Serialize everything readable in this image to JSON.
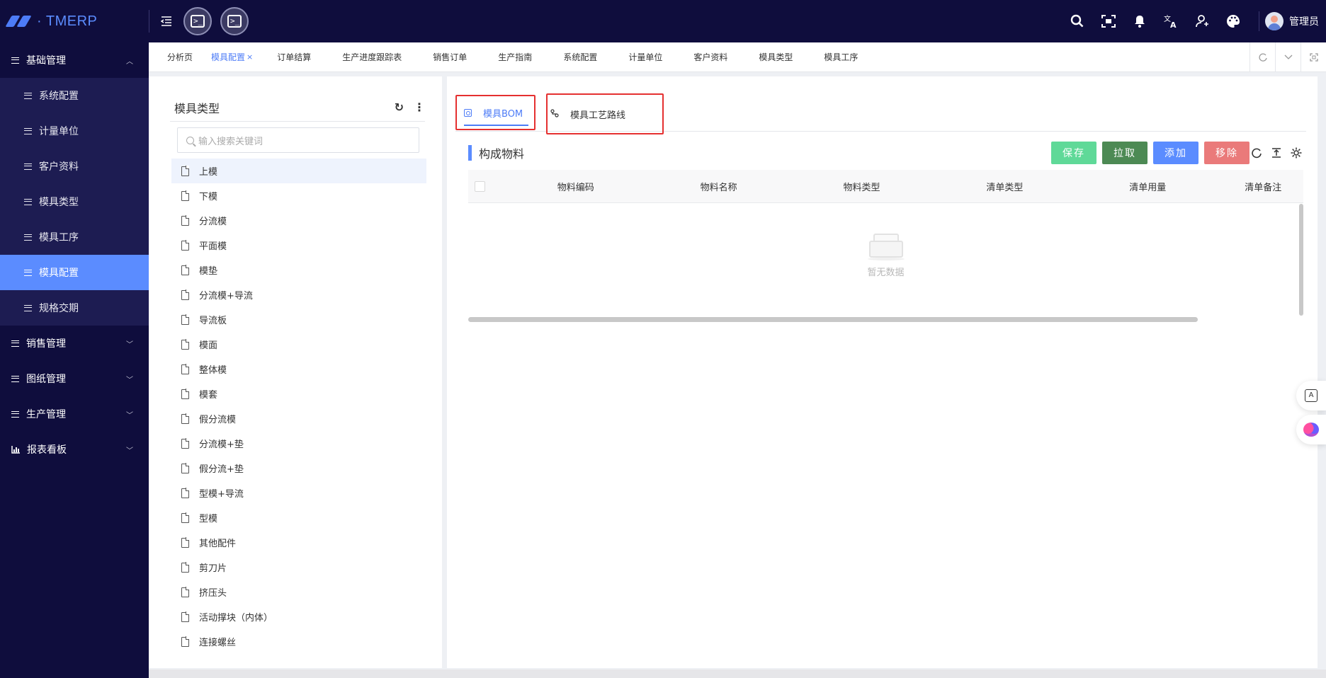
{
  "app": {
    "logo_text": "· TMERP"
  },
  "header": {
    "user_name": "管理员"
  },
  "sidebar": {
    "groups": [
      {
        "label": "基础管理",
        "expanded": true,
        "items": [
          "系统配置",
          "计量单位",
          "客户资料",
          "模具类型",
          "模具工序",
          "模具配置",
          "规格交期"
        ],
        "active_item": "模具配置"
      },
      {
        "label": "销售管理",
        "expanded": false
      },
      {
        "label": "图纸管理",
        "expanded": false
      },
      {
        "label": "生产管理",
        "expanded": false
      },
      {
        "label": "报表看板",
        "expanded": false
      }
    ]
  },
  "tabs": [
    "分析页",
    "模具配置",
    "订单结算",
    "生产进度跟踪表",
    "销售订单",
    "生产指南",
    "系统配置",
    "计量单位",
    "客户资料",
    "模具类型",
    "模具工序"
  ],
  "active_tab": "模具配置",
  "tab_close_glyph": "×",
  "left_panel": {
    "title": "模具类型",
    "refresh_glyph": "↻",
    "more_glyph": "⋮",
    "search_placeholder": "输入搜索关键词",
    "items": [
      "上模",
      "下模",
      "分流模",
      "平面模",
      "模垫",
      "分流模+导流",
      "导流板",
      "模面",
      "整体模",
      "模套",
      "假分流模",
      "分流模+垫",
      "假分流+垫",
      "型模+导流",
      "型模",
      "其他配件",
      "剪刀片",
      "挤压头",
      "活动撑块（内体）",
      "连接螺丝"
    ],
    "selected_item": "上模"
  },
  "right_panel": {
    "tabs": [
      {
        "label": "模具BOM",
        "icon": "bom-icon",
        "active": true
      },
      {
        "label": "模具工艺路线",
        "icon": "route-icon",
        "active": false
      }
    ],
    "section_title": "构成物料",
    "buttons": {
      "save": "保存",
      "pull": "拉取",
      "add": "添加",
      "remove": "移除"
    },
    "table": {
      "columns": [
        "物料编码",
        "物料名称",
        "物料类型",
        "清单类型",
        "清单用量",
        "清单备注"
      ],
      "rows": [],
      "empty_text": "暂无数据"
    }
  },
  "colors": {
    "nav_bg": "#0f0d3d",
    "accent": "#5b8cff",
    "save": "#5fd998",
    "pull": "#4d8a54",
    "add": "#5b8cff",
    "remove": "#ea7a7a",
    "highlight_border": "#e53030"
  }
}
